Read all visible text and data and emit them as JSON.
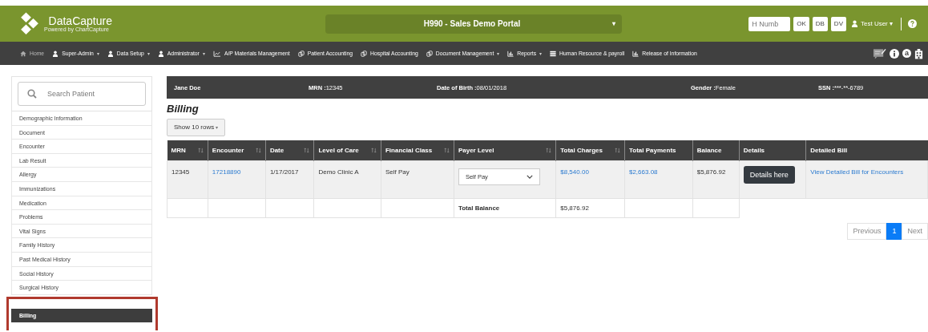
{
  "header": {
    "logo": "**Data**Capture",
    "logo_tagline": "Powered by ChartCapture",
    "portal": {
      "value": "H990 - Sales Demo Portal",
      "caret": "▾"
    },
    "h_field": {
      "placeholder": "H Numb"
    },
    "buttons": [
      "OK",
      "DB",
      "DV"
    ],
    "user": {
      "name": "Test User",
      "caret": "▾"
    }
  },
  "nav": {
    "items": [
      {
        "label": "Home",
        "kind": "home",
        "dropdown": false
      },
      {
        "label": "Super-Admin",
        "kind": "user",
        "dropdown": true
      },
      {
        "label": "Data Setup",
        "kind": "user",
        "dropdown": true
      },
      {
        "label": "Administrator",
        "kind": "user",
        "dropdown": true
      },
      {
        "label": "A/P Materials Management",
        "kind": "line",
        "dropdown": false
      },
      {
        "label": "Patient Accounting",
        "kind": "copy",
        "dropdown": false
      },
      {
        "label": "Hospital Accounting",
        "kind": "copy",
        "dropdown": false
      },
      {
        "label": "Document Management",
        "kind": "copy",
        "dropdown": true
      },
      {
        "label": "Reports",
        "kind": "bars",
        "dropdown": true
      },
      {
        "label": "Human Resource & payroll",
        "kind": "list",
        "dropdown": false
      },
      {
        "label": "Release of Information",
        "kind": "bars",
        "dropdown": false
      }
    ],
    "caret": "▾",
    "letter": "a"
  },
  "sidebar": {
    "search": {
      "placeholder": "Search Patient"
    },
    "items": [
      {
        "label": "Demographic Information",
        "selected": false,
        "highlighted": false
      },
      {
        "label": "Document",
        "selected": false,
        "highlighted": false
      },
      {
        "label": "Encounter",
        "selected": false,
        "highlighted": false
      },
      {
        "label": "Lab Result",
        "selected": false,
        "highlighted": false
      },
      {
        "label": "Allergy",
        "selected": false,
        "highlighted": false
      },
      {
        "label": "Immunizations",
        "selected": false,
        "highlighted": false
      },
      {
        "label": "Medication",
        "selected": false,
        "highlighted": false
      },
      {
        "label": "Problems",
        "selected": false,
        "highlighted": false
      },
      {
        "label": "Vital Signs",
        "selected": false,
        "highlighted": false
      },
      {
        "label": "Family History",
        "selected": false,
        "highlighted": false
      },
      {
        "label": "Past Medical History",
        "selected": false,
        "highlighted": false
      },
      {
        "label": "Social History",
        "selected": false,
        "highlighted": false
      },
      {
        "label": "Surgical History",
        "selected": false,
        "highlighted": false
      },
      {
        "label": "Billing",
        "selected": true,
        "highlighted": true
      }
    ]
  },
  "patient": [
    {
      "label": "Jane Doe"
    },
    {
      "label": "MRN :",
      "value": "12345"
    },
    {
      "label": "Date of Birth :",
      "value": "08/01/2018"
    },
    {
      "label": "Gender :",
      "value": "Female"
    },
    {
      "label": "SSN :",
      "value": "***-**-6789"
    }
  ],
  "title": "Billing",
  "rows_button": {
    "label": "Show 10 rows",
    "caret": "▾"
  },
  "table": {
    "columns": [
      {
        "label": "MRN",
        "sortable": true
      },
      {
        "label": "Encounter",
        "sortable": true
      },
      {
        "label": "Date",
        "sortable": true
      },
      {
        "label": "Level of Care",
        "sortable": true
      },
      {
        "label": "Financial Class",
        "sortable": true
      },
      {
        "label": "Payer Level",
        "sortable": true
      },
      {
        "label": "Total Charges",
        "sortable": true
      },
      {
        "label": "Total Payments",
        "sortable": false
      },
      {
        "label": "Balance",
        "sortable": false
      },
      {
        "label": "Details",
        "sortable": false
      },
      {
        "label": "Detailed Bill",
        "sortable": false
      }
    ],
    "rows": [
      {
        "cells": [
          {
            "kind": "text",
            "text": "12345"
          },
          {
            "kind": "link",
            "text": "17218890"
          },
          {
            "kind": "text",
            "text": "1/17/2017"
          },
          {
            "kind": "text",
            "text": "Demo Clinic A"
          },
          {
            "kind": "text",
            "text": "Self Pay"
          },
          {
            "kind": "select",
            "text": "Self Pay"
          },
          {
            "kind": "link",
            "text": "$8,540.00"
          },
          {
            "kind": "link",
            "text": "$2,663.08"
          },
          {
            "kind": "text",
            "text": "$5,876.92"
          },
          {
            "kind": "button",
            "text": "Details here"
          },
          {
            "kind": "link",
            "text": "View Detailed Bill for Encounters"
          }
        ]
      }
    ],
    "total": {
      "label": "Total Balance",
      "value": "$5,876.92"
    }
  },
  "pagination": [
    {
      "label": "Previous",
      "selected": false
    },
    {
      "label": "1",
      "selected": true
    },
    {
      "label": "Next",
      "selected": false
    }
  ]
}
